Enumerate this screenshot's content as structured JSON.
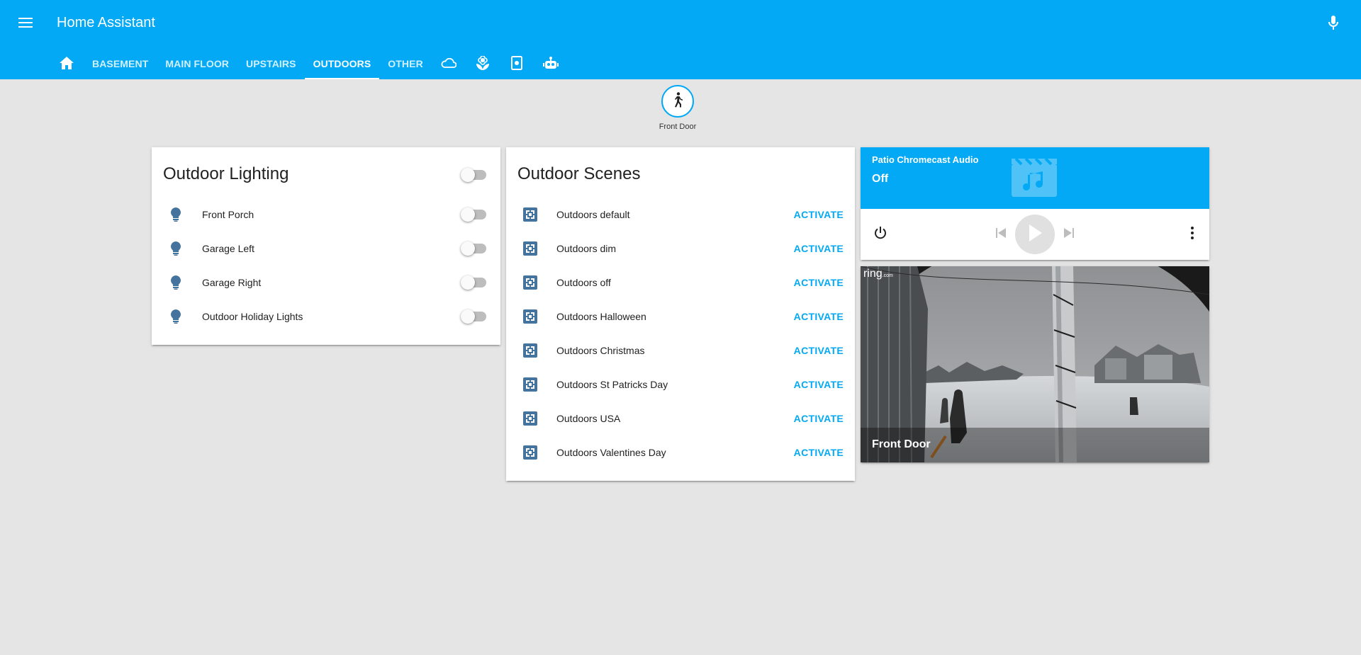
{
  "app": {
    "title": "Home Assistant",
    "accent_color": "#03a9f4",
    "menu_icon": "menu-icon",
    "mic_icon": "microphone-icon"
  },
  "tabs": [
    {
      "icon": "home-icon",
      "label": ""
    },
    {
      "label": "BASEMENT"
    },
    {
      "label": "MAIN FLOOR"
    },
    {
      "label": "UPSTAIRS"
    },
    {
      "label": "OUTDOORS",
      "active": true
    },
    {
      "label": "OTHER"
    },
    {
      "icon": "cloud-icon",
      "label": ""
    },
    {
      "icon": "flower-icon",
      "label": ""
    },
    {
      "icon": "tablet-icon",
      "label": ""
    },
    {
      "icon": "robot-icon",
      "label": ""
    }
  ],
  "badge": {
    "label": "Front Door",
    "icon": "walk-icon"
  },
  "lighting": {
    "title": "Outdoor Lighting",
    "group_toggle_on": false,
    "items": [
      {
        "label": "Front Porch",
        "icon": "lightbulb-icon",
        "on": false
      },
      {
        "label": "Garage Left",
        "icon": "lightbulb-icon",
        "on": false
      },
      {
        "label": "Garage Right",
        "icon": "lightbulb-icon",
        "on": false
      },
      {
        "label": "Outdoor Holiday Lights",
        "icon": "lightbulb-icon",
        "on": false
      }
    ]
  },
  "scenes": {
    "title": "Outdoor Scenes",
    "action_label": "ACTIVATE",
    "items": [
      {
        "label": "Outdoors default",
        "icon": "scene-icon"
      },
      {
        "label": "Outdoors dim",
        "icon": "scene-icon"
      },
      {
        "label": "Outdoors off",
        "icon": "scene-icon"
      },
      {
        "label": "Outdoors Halloween",
        "icon": "scene-icon"
      },
      {
        "label": "Outdoors Christmas",
        "icon": "scene-icon"
      },
      {
        "label": "Outdoors St Patricks Day",
        "icon": "scene-icon"
      },
      {
        "label": "Outdoors USA",
        "icon": "scene-icon"
      },
      {
        "label": "Outdoors Valentines Day",
        "icon": "scene-icon"
      }
    ]
  },
  "media": {
    "name": "Patio Chromecast Audio",
    "state": "Off",
    "art_icon": "music-video-icon"
  },
  "camera": {
    "title": "Front Door",
    "logo": "ring",
    "logo_suffix": ".com"
  }
}
